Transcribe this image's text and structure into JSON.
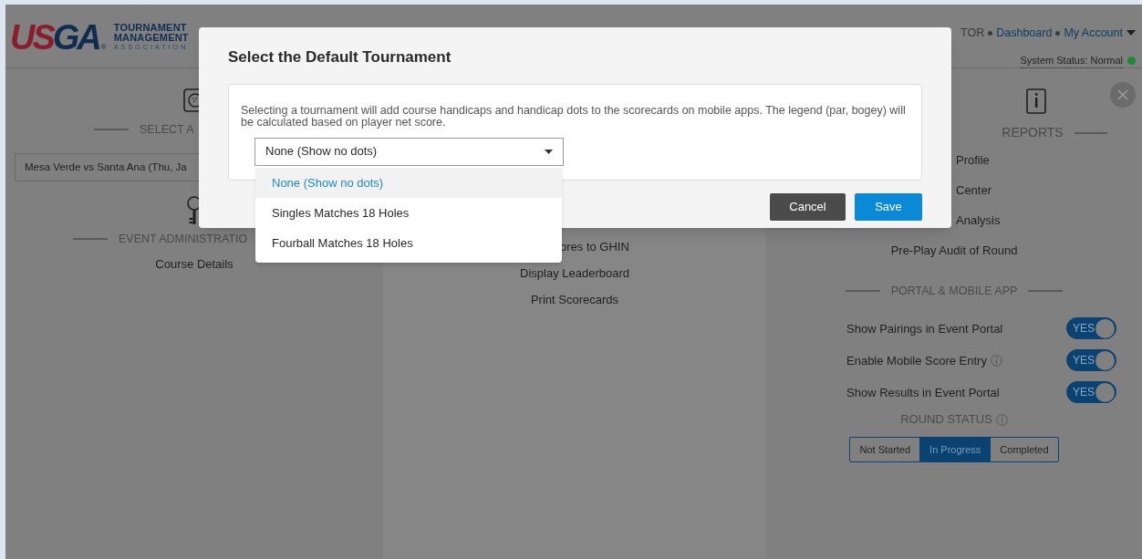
{
  "header": {
    "logo": {
      "wordmark": [
        {
          "text": "US",
          "color": "#8a1c2c"
        },
        {
          "text": "GA",
          "color": "#0f2d50"
        }
      ],
      "registered": "®",
      "lines": [
        "TOURNAMENT",
        "MANAGEMENT"
      ],
      "tagline": "ASSOCIATION"
    },
    "user_nav": [
      {
        "kind": "text",
        "text": "TOR"
      },
      {
        "kind": "link",
        "text": "Dashboard"
      },
      {
        "kind": "link",
        "text": "My Account"
      }
    ],
    "system_status": {
      "text": "System Status: Normal",
      "color": "#1f8a3a"
    }
  },
  "left_column": {
    "select_heading": "SELECT A",
    "select_value": "Mesa Verde vs Santa Ana (Thu, Ja",
    "admin_heading": "EVENT ADMINISTRATIO",
    "admin_links": [
      "Course Details"
    ]
  },
  "middle_column": {
    "links": [
      "ores to GHIN",
      "Display Leaderboard",
      "Print Scorecards"
    ]
  },
  "right_column": {
    "reports_heading": "REPORTS",
    "report_links": [
      "Profile",
      "Center",
      "Analysis"
    ],
    "audit_link": "Pre-Play Audit of Round",
    "portal_heading": "PORTAL & MOBILE APP",
    "toggles": [
      {
        "label": "Show Pairings in Event Portal",
        "info": false,
        "on": true,
        "text": "YES"
      },
      {
        "label": "Enable Mobile Score Entry",
        "info": true,
        "on": true,
        "text": "YES"
      },
      {
        "label": "Show Results in Event Portal",
        "info": false,
        "on": true,
        "text": "YES"
      }
    ],
    "round_status": {
      "heading": "ROUND STATUS",
      "options": [
        {
          "label": "Not Started",
          "selected": false
        },
        {
          "label": "In Progress",
          "selected": true
        },
        {
          "label": "Completed",
          "selected": false
        }
      ]
    }
  },
  "modal": {
    "title": "Select the Default Tournament",
    "description": "Selecting a tournament will add course handicaps and handicap dots to the scorecards on mobile apps. The legend (par, bogey) will be calculated based on player net score.",
    "select_value": "None (Show no dots)",
    "options": [
      {
        "label": "None (Show no dots)",
        "selected": true
      },
      {
        "label": "Singles Matches 18 Holes",
        "selected": false
      },
      {
        "label": "Fourball Matches 18 Holes",
        "selected": false
      }
    ],
    "buttons": [
      {
        "label": "Cancel",
        "kind": "secondary"
      },
      {
        "label": "Save",
        "kind": "primary"
      }
    ]
  }
}
